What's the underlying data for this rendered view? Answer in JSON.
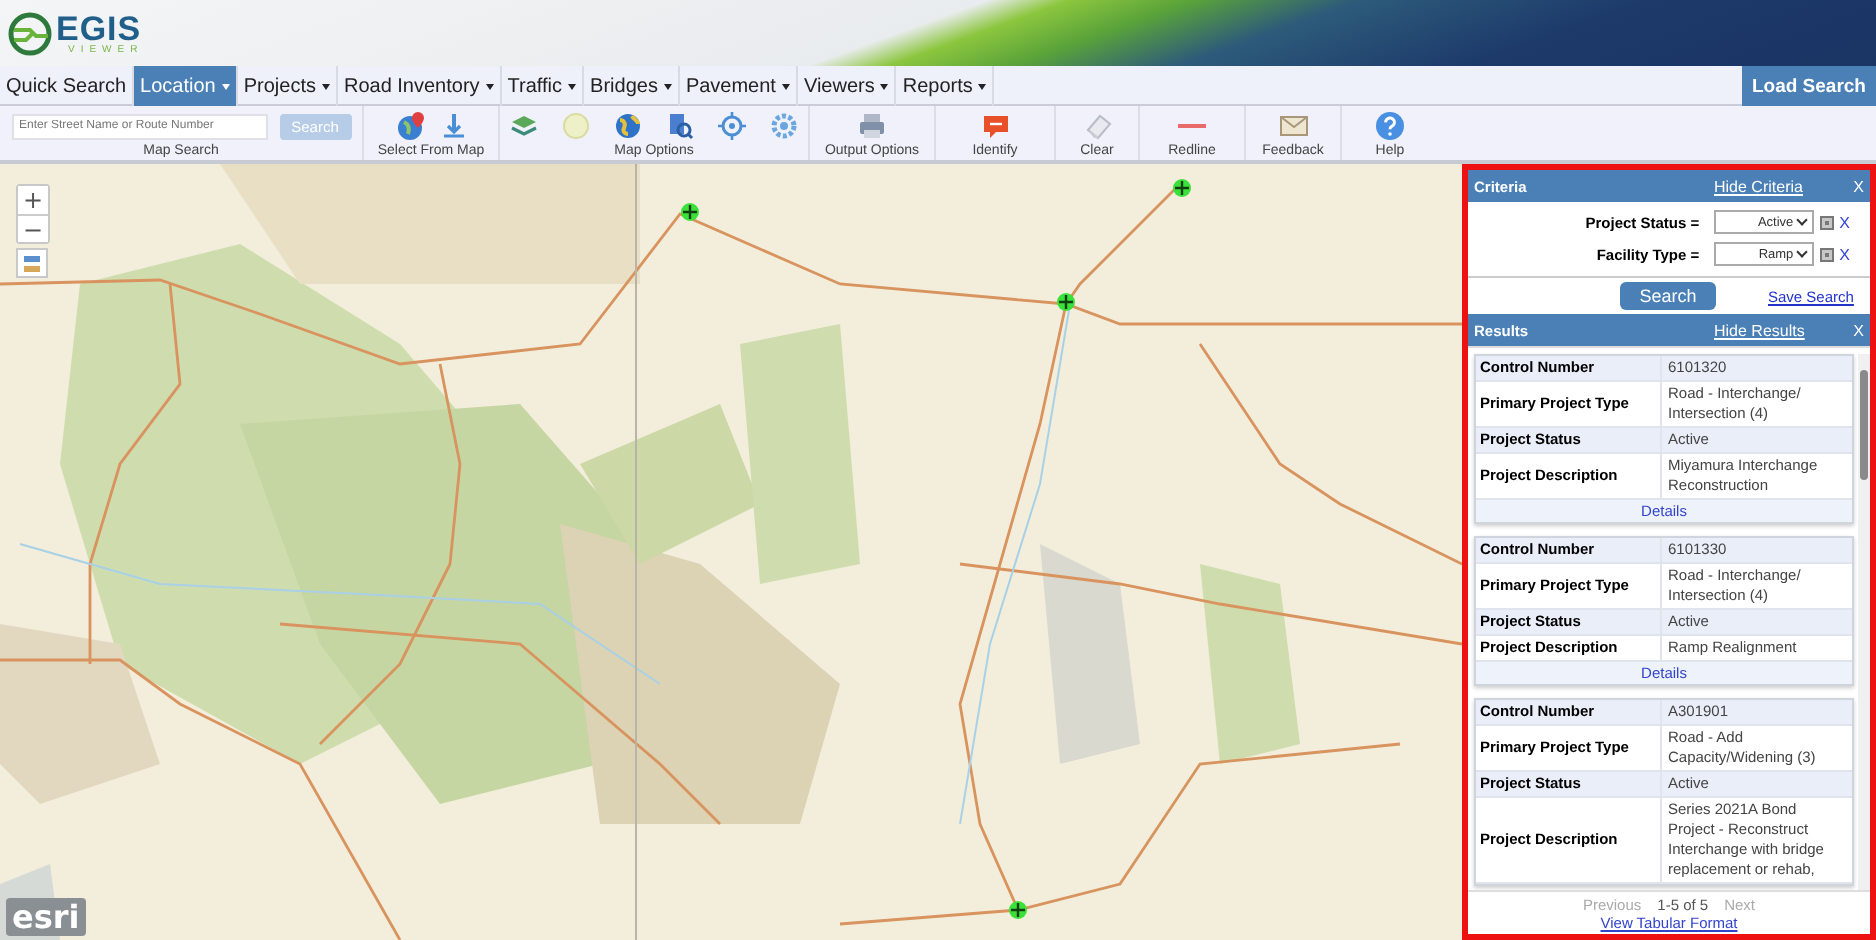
{
  "header": {
    "logo_title": "EGIS",
    "logo_subtitle": "VIEWER"
  },
  "nav": {
    "items": [
      {
        "label": "Quick Search",
        "has_menu": false,
        "selected": false
      },
      {
        "label": "Location",
        "has_menu": true,
        "selected": true
      },
      {
        "label": "Projects",
        "has_menu": true,
        "selected": false
      },
      {
        "label": "Road Inventory",
        "has_menu": true,
        "selected": false
      },
      {
        "label": "Traffic",
        "has_menu": true,
        "selected": false
      },
      {
        "label": "Bridges",
        "has_menu": true,
        "selected": false
      },
      {
        "label": "Pavement",
        "has_menu": true,
        "selected": false
      },
      {
        "label": "Viewers",
        "has_menu": true,
        "selected": false
      },
      {
        "label": "Reports",
        "has_menu": true,
        "selected": false
      }
    ],
    "action": "Load Search"
  },
  "toolbar": {
    "groups": [
      {
        "kind": "search",
        "label": "Map Search",
        "placeholder": "Enter Street Name or Route Number",
        "button": "Search",
        "button_disabled": true
      },
      {
        "kind": "select",
        "label": "Select From Map"
      },
      {
        "kind": "map-options",
        "label": "Map Options"
      },
      {
        "kind": "output",
        "label": "Output Options"
      },
      {
        "kind": "identify",
        "label": "Identify"
      },
      {
        "kind": "clear",
        "label": "Clear"
      },
      {
        "kind": "redline",
        "label": "Redline"
      },
      {
        "kind": "feedback",
        "label": "Feedback"
      },
      {
        "kind": "help",
        "label": "Help"
      }
    ]
  },
  "map": {
    "zoom_in": "+",
    "zoom_out": "−",
    "attribution": "esri"
  },
  "criteria": {
    "title": "Criteria",
    "toggle": "Hide Criteria",
    "close": "X",
    "filters": [
      {
        "label": "Project Status =",
        "value": "Active",
        "checked": true,
        "remove": "X"
      },
      {
        "label": "Facility Type =",
        "value": "Ramp",
        "checked": true,
        "remove": "X"
      }
    ],
    "search_button": "Search",
    "save_link": "Save Search"
  },
  "results": {
    "title": "Results",
    "toggle": "Hide Results",
    "close": "X",
    "records": [
      {
        "fields": [
          {
            "label": "Control Number",
            "value": "6101320"
          },
          {
            "label": "Primary Project Type",
            "value": "Road - Interchange/ Intersection (4)"
          },
          {
            "label": "Project Status",
            "value": "Active"
          },
          {
            "label": "Project Description",
            "value": "Miyamura Interchange Reconstruction"
          }
        ],
        "details": "Details"
      },
      {
        "fields": [
          {
            "label": "Control Number",
            "value": "6101330"
          },
          {
            "label": "Primary Project Type",
            "value": "Road - Interchange/ Intersection (4)"
          },
          {
            "label": "Project Status",
            "value": "Active"
          },
          {
            "label": "Project Description",
            "value": "Ramp Realignment"
          }
        ],
        "details": "Details"
      },
      {
        "fields": [
          {
            "label": "Control Number",
            "value": "A301901"
          },
          {
            "label": "Primary Project Type",
            "value": "Road - Add Capacity/Widening (3)"
          },
          {
            "label": "Project Status",
            "value": "Active"
          },
          {
            "label": "Project Description",
            "value": "Series 2021A Bond Project - Reconstruct Interchange with bridge replacement or rehab,"
          }
        ]
      }
    ],
    "pager": {
      "previous": "Previous",
      "previous_disabled": true,
      "range": "1-5 of 5",
      "next": "Next",
      "next_disabled": true
    },
    "tabular_link": "View Tabular Format"
  }
}
